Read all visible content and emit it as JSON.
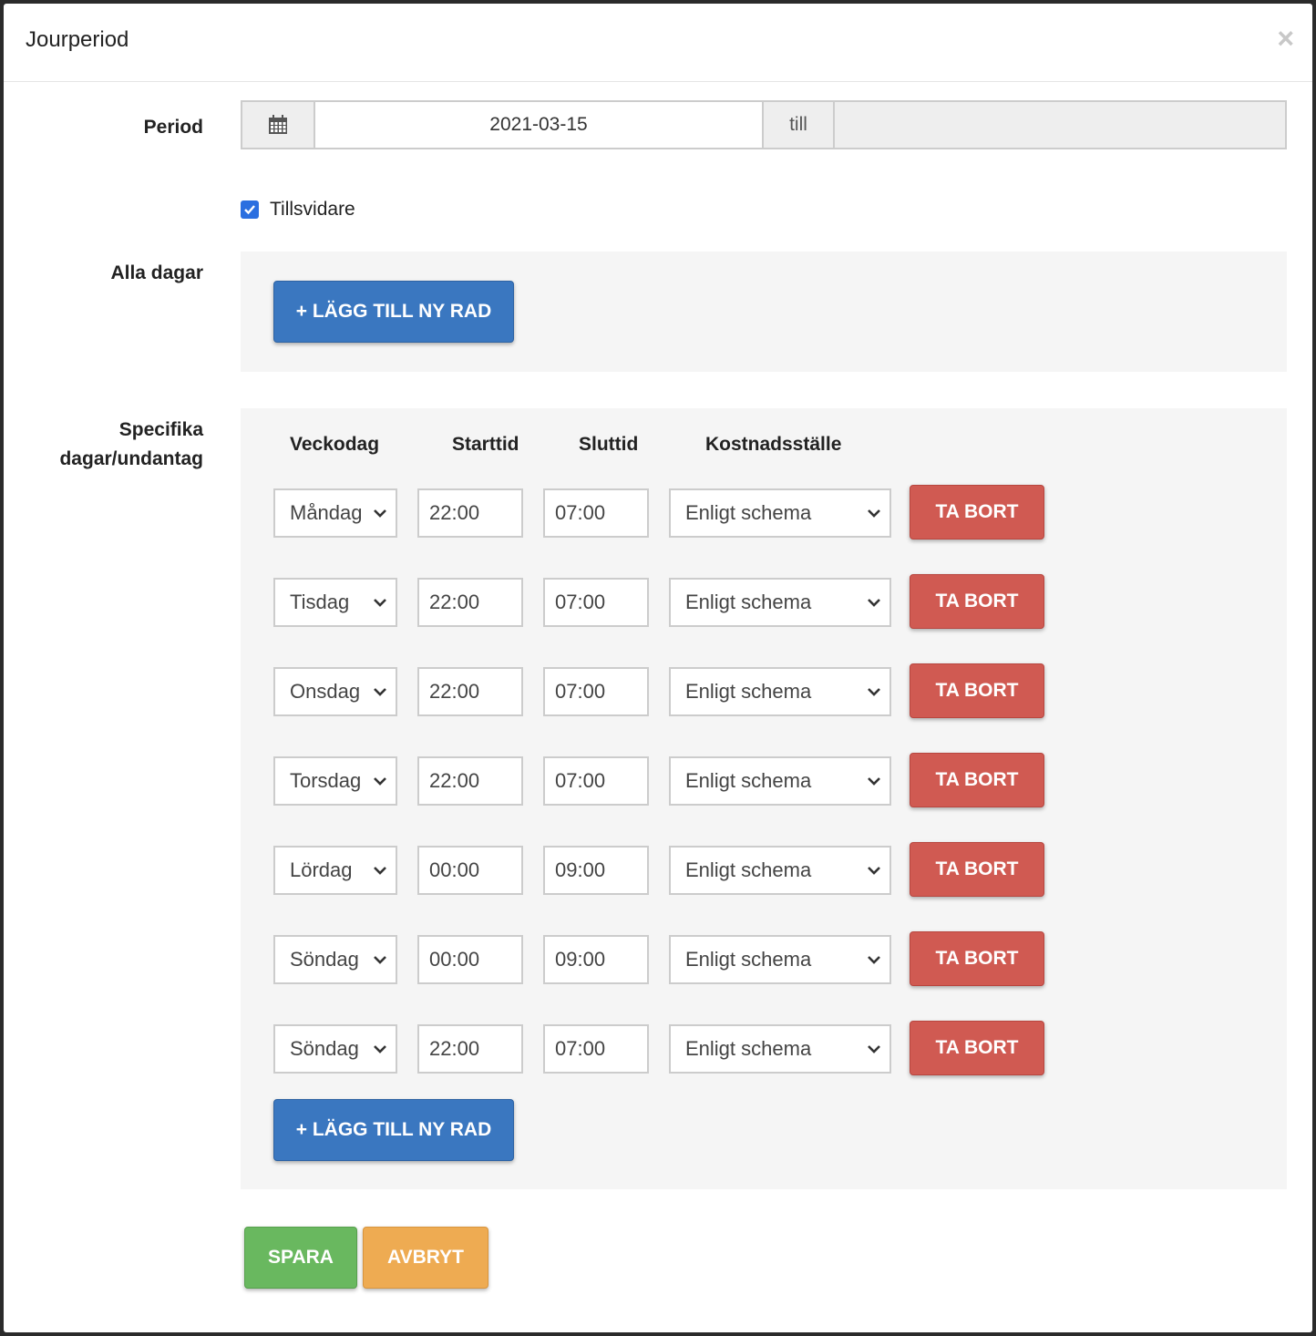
{
  "modal": {
    "title": "Jourperiod",
    "close_glyph": "×"
  },
  "period": {
    "label": "Period",
    "calendar_icon": "calendar-icon",
    "from_value": "2021-03-15",
    "separator": "till",
    "to_value": ""
  },
  "tillsvidare": {
    "label": "Tillsvidare",
    "checked": true
  },
  "alla_dagar": {
    "label": "Alla dagar",
    "add_button": "+ LÄGG TILL NY RAD"
  },
  "specifika": {
    "label_line1": "Specifika",
    "label_line2": "dagar/undantag",
    "headers": {
      "weekday": "Veckodag",
      "start": "Starttid",
      "end": "Sluttid",
      "cost": "Kostnadsställe"
    },
    "rows": [
      {
        "weekday": "Måndag",
        "start": "22:00",
        "end": "07:00",
        "cost": "Enligt schema",
        "remove": "TA BORT"
      },
      {
        "weekday": "Tisdag",
        "start": "22:00",
        "end": "07:00",
        "cost": "Enligt schema",
        "remove": "TA BORT"
      },
      {
        "weekday": "Onsdag",
        "start": "22:00",
        "end": "07:00",
        "cost": "Enligt schema",
        "remove": "TA BORT"
      },
      {
        "weekday": "Torsdag",
        "start": "22:00",
        "end": "07:00",
        "cost": "Enligt schema",
        "remove": "TA BORT"
      },
      {
        "weekday": "Lördag",
        "start": "00:00",
        "end": "09:00",
        "cost": "Enligt schema",
        "remove": "TA BORT"
      },
      {
        "weekday": "Söndag",
        "start": "00:00",
        "end": "09:00",
        "cost": "Enligt schema",
        "remove": "TA BORT"
      },
      {
        "weekday": "Söndag",
        "start": "22:00",
        "end": "07:00",
        "cost": "Enligt schema",
        "remove": "TA BORT"
      }
    ],
    "add_button": "+ LÄGG TILL NY RAD"
  },
  "footer": {
    "save": "SPARA",
    "cancel": "AVBRYT"
  },
  "colors": {
    "primary": "#3a77c0",
    "danger": "#d05a52",
    "success": "#69b85f",
    "warning": "#eeab52",
    "checkbox": "#2b6fe0"
  }
}
